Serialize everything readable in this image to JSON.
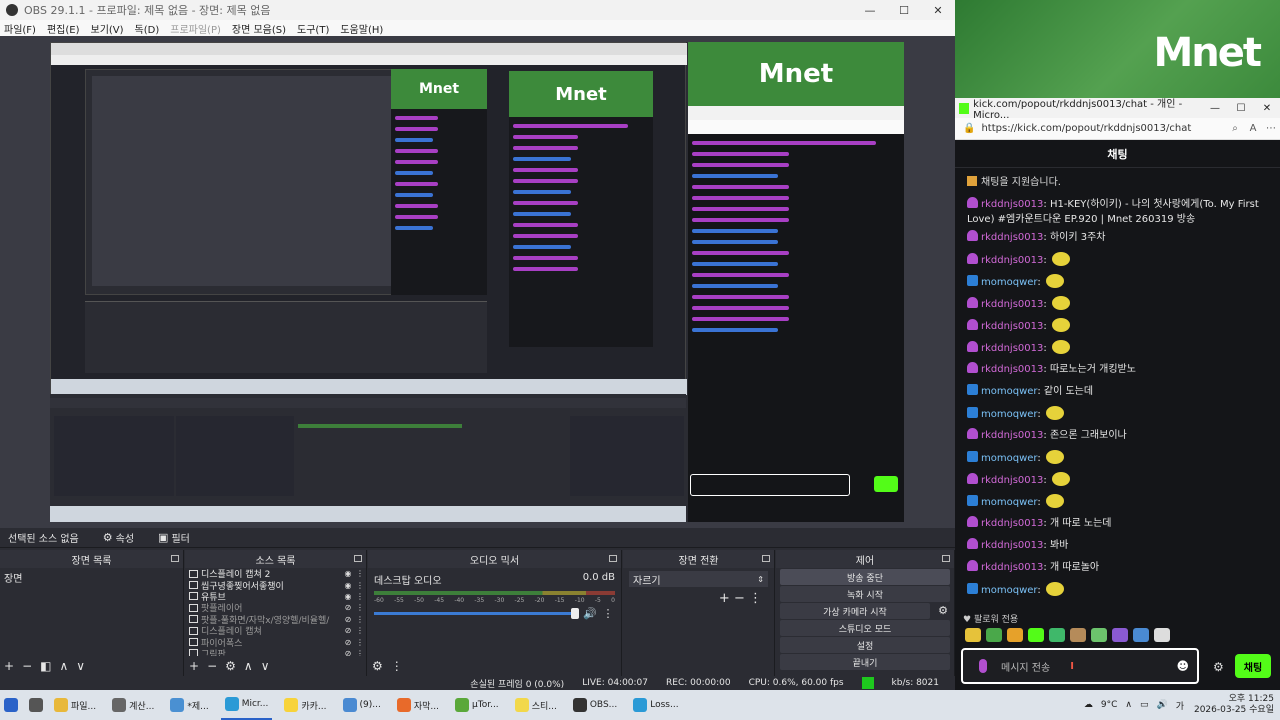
{
  "obs": {
    "title": "OBS 29.1.1 - 프로파일: 제목 없음 - 장면: 제목 없음",
    "menu": [
      {
        "label": "파일(F)",
        "dim": false
      },
      {
        "label": "편집(E)",
        "dim": false
      },
      {
        "label": "보기(V)",
        "dim": false
      },
      {
        "label": "독(D)",
        "dim": false
      },
      {
        "label": "프로파일(P)",
        "dim": true
      },
      {
        "label": "장면 모음(S)",
        "dim": false
      },
      {
        "label": "도구(T)",
        "dim": false
      },
      {
        "label": "도움말(H)",
        "dim": false
      }
    ],
    "source_bar": {
      "no_source": "선택된 소스 없음",
      "properties": "속성",
      "filters": "필터"
    },
    "docks": {
      "scenes": {
        "title": "장면 목록",
        "items": [
          "장면"
        ]
      },
      "sources": {
        "title": "소스 목록",
        "items": [
          {
            "name": "디스플레이 캡쳐 2",
            "hidden": false
          },
          {
            "name": "씹구녕좋찢어서좋챙이",
            "hidden": false
          },
          {
            "name": "유튜브",
            "hidden": false
          },
          {
            "name": "팟플레이어",
            "hidden": true
          },
          {
            "name": "팟플-풀화면/자막x/영양헬/비율헬/",
            "hidden": true
          },
          {
            "name": "디스플레이 캡쳐",
            "hidden": true
          },
          {
            "name": "파이어폭스",
            "hidden": true
          },
          {
            "name": "그림판",
            "hidden": true
          }
        ]
      },
      "mixer": {
        "title": "오디오 믹서",
        "channel": "데스크탑 오디오",
        "level": "0.0 dB",
        "ticks": [
          "-60",
          "-55",
          "-50",
          "-45",
          "-40",
          "-35",
          "-30",
          "-25",
          "-20",
          "-15",
          "-10",
          "-5",
          "0"
        ]
      },
      "transitions": {
        "title": "장면 전환",
        "selected": "자르기"
      },
      "controls": {
        "title": "제어",
        "buttons": [
          {
            "label": "방송 중단",
            "active": true
          },
          {
            "label": "녹화 시작",
            "active": false
          },
          {
            "label": "가상 카메라 시작",
            "active": false
          },
          {
            "label": "스튜디오 모드",
            "active": false
          },
          {
            "label": "설정",
            "active": false
          },
          {
            "label": "끝내기",
            "active": false
          }
        ]
      }
    },
    "status": {
      "dropped": "손실된 프레임 0 (0.0%)",
      "live": "LIVE: 04:00:07",
      "rec": "REC: 00:00:00",
      "cpu": "CPU: 0.6%, 60.00 fps",
      "kbps": "kb/s: 8021"
    }
  },
  "mnet": {
    "logo": "Mnet"
  },
  "kick": {
    "window_title": "kick.com/popout/rkddnjs0013/chat - 개인 - Micro...",
    "url": "https://kick.com/popout/rkddnjs0013/chat",
    "header": "채팅",
    "notice": "채팅을 지원습니다.",
    "messages": [
      {
        "user": "rkddnjs0013",
        "type": "pu",
        "text": "H1-KEY(하이키) - 나의 첫사랑에게(To. My First Love) #엠카운트다운 EP.920 | Mnet 260319 방송",
        "emote": false
      },
      {
        "user": "rkddnjs0013",
        "type": "pu",
        "text": "하이키 3주차",
        "emote": false
      },
      {
        "user": "rkddnjs0013",
        "type": "pu",
        "text": "",
        "emote": true
      },
      {
        "user": "momoqwer",
        "type": "bl",
        "text": "",
        "emote": true
      },
      {
        "user": "rkddnjs0013",
        "type": "pu",
        "text": "",
        "emote": true
      },
      {
        "user": "rkddnjs0013",
        "type": "pu",
        "text": "",
        "emote": true
      },
      {
        "user": "rkddnjs0013",
        "type": "pu",
        "text": "",
        "emote": true
      },
      {
        "user": "rkddnjs0013",
        "type": "pu",
        "text": "따로노는거 개킹받노",
        "emote": false
      },
      {
        "user": "momoqwer",
        "type": "bl",
        "text": "같이 도는데",
        "emote": false
      },
      {
        "user": "momoqwer",
        "type": "bl",
        "text": "",
        "emote": true
      },
      {
        "user": "rkddnjs0013",
        "type": "pu",
        "text": "존으론 그래보이나",
        "emote": false
      },
      {
        "user": "momoqwer",
        "type": "bl",
        "text": "",
        "emote": true
      },
      {
        "user": "rkddnjs0013",
        "type": "pu",
        "text": "",
        "emote": true
      },
      {
        "user": "momoqwer",
        "type": "bl",
        "text": "",
        "emote": true
      },
      {
        "user": "rkddnjs0013",
        "type": "pu",
        "text": "개 따로 노는데",
        "emote": false
      },
      {
        "user": "rkddnjs0013",
        "type": "pu",
        "text": "봐바",
        "emote": false
      },
      {
        "user": "rkddnjs0013",
        "type": "pu",
        "text": "개 따로놀아",
        "emote": false
      },
      {
        "user": "momoqwer",
        "type": "bl",
        "text": "",
        "emote": true
      }
    ],
    "follow_label": "팔로워 전용",
    "emote_colors": [
      "#e6c23a",
      "#4aa84a",
      "#e6a12a",
      "#53fc18",
      "#3fb86a",
      "#b58b5a",
      "#6cc36c",
      "#8a5ad2",
      "#4a8ad2",
      "#dddddd"
    ],
    "input_placeholder": "메시지 전송",
    "send_label": "채팅"
  },
  "taskbar": {
    "items": [
      {
        "label": "파일...",
        "color": "#e8b83a",
        "active": false
      },
      {
        "label": "계산...",
        "color": "#666666",
        "active": false
      },
      {
        "label": "*제...",
        "color": "#4a90d2",
        "active": false
      },
      {
        "label": "Micr...",
        "color": "#2a9ad6",
        "active": true
      },
      {
        "label": "카카...",
        "color": "#f7d33a",
        "active": false
      },
      {
        "label": "(9)...",
        "color": "#4a8ad2",
        "active": false
      },
      {
        "label": "자막...",
        "color": "#e86a2a",
        "active": false
      },
      {
        "label": "µTor...",
        "color": "#5aa83a",
        "active": false
      },
      {
        "label": "스티...",
        "color": "#f2d84a",
        "active": false
      },
      {
        "label": "OBS...",
        "color": "#333333",
        "active": false
      },
      {
        "label": "Loss...",
        "color": "#2a9ad6",
        "active": false
      }
    ],
    "weather": "9°C",
    "time": "오후 11:25",
    "date": "2026-03-25 수요일",
    "lang": "가"
  }
}
